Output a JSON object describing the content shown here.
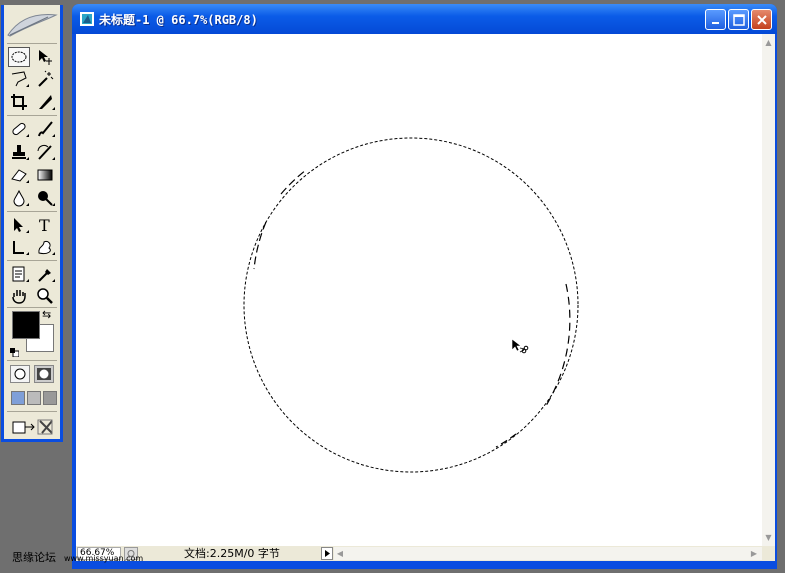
{
  "document": {
    "title": "未标题-1 @ 66.7%(RGB/8)",
    "zoom_value": "66.67%",
    "doc_info": "文档:2.25M/0 字节"
  },
  "toolbox": {
    "tools": [
      {
        "name": "elliptical-marquee",
        "active": true
      },
      {
        "name": "move"
      },
      {
        "name": "polygonal-lasso"
      },
      {
        "name": "magic-wand"
      },
      {
        "name": "crop"
      },
      {
        "name": "slice"
      },
      {
        "name": "healing-brush"
      },
      {
        "name": "brush"
      },
      {
        "name": "clone-stamp"
      },
      {
        "name": "history-brush"
      },
      {
        "name": "eraser"
      },
      {
        "name": "gradient"
      },
      {
        "name": "blur"
      },
      {
        "name": "dodge"
      },
      {
        "name": "path-selection"
      },
      {
        "name": "type"
      },
      {
        "name": "pen"
      },
      {
        "name": "custom-shape"
      },
      {
        "name": "notes"
      },
      {
        "name": "eyedropper"
      },
      {
        "name": "hand"
      },
      {
        "name": "zoom"
      }
    ],
    "foreground_color": "#000000",
    "background_color": "#ffffff"
  },
  "watermark": {
    "text": "思缘论坛",
    "url": "www.missyuan.com"
  },
  "colors": {
    "titlebar": "#0b5ce8",
    "workspace": "#6f6f6f",
    "toolbox_face": "#ece9d8"
  }
}
